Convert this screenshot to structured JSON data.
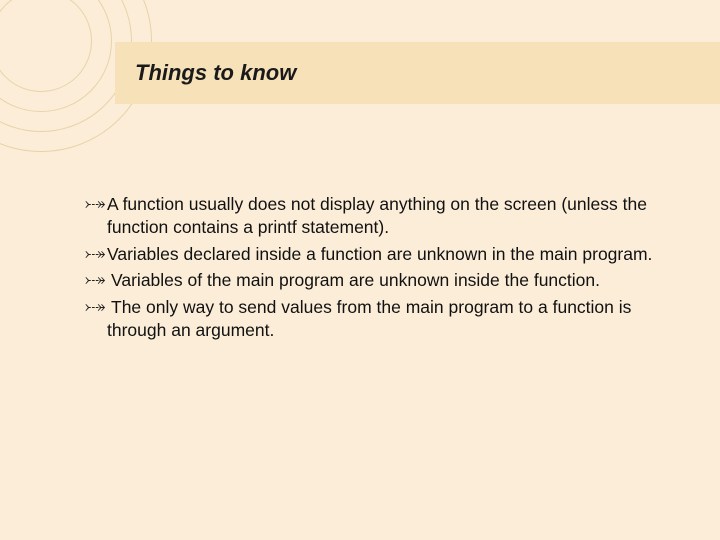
{
  "title": "Things to know",
  "bullets": [
    "A function usually does not display anything on the screen (unless the function contains a printf statement).",
    "Variables declared inside a function are unknown in the main program.",
    " Variables of the main program are unknown inside the function.",
    " The only way to send values from the main program to a function is through an argument."
  ]
}
